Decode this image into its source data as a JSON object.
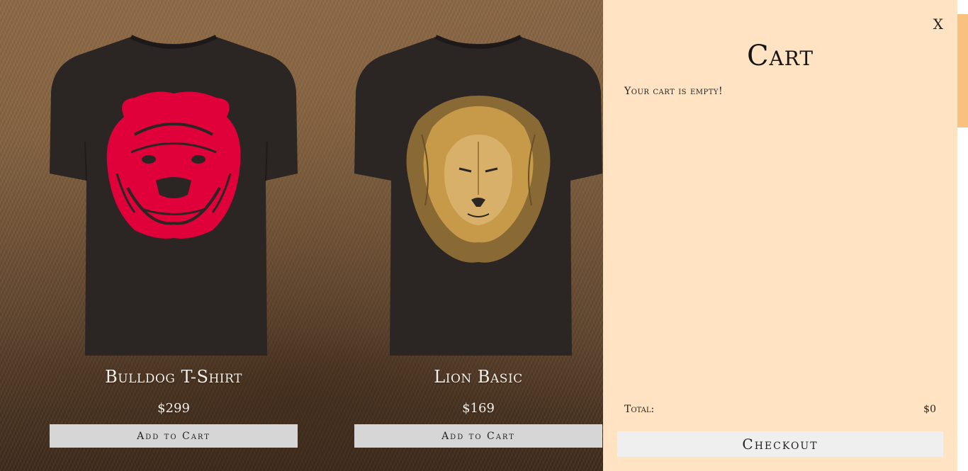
{
  "products": [
    {
      "name": "Bulldog T-Shirt",
      "price": "$299",
      "add_label": "Add to Cart",
      "print_icon": "bulldog-print",
      "print_color": "#e0003a"
    },
    {
      "name": "Lion Basic",
      "price": "$169",
      "add_label": "Add to Cart",
      "print_icon": "lion-print",
      "print_color": "#c79a4a"
    }
  ],
  "cart": {
    "close_label": "X",
    "title": "Cart",
    "empty_message": "Your cart is empty!",
    "total_label": "Total:",
    "total_value": "$0",
    "checkout_label": "Checkout",
    "background": "#ffe3c2",
    "scrollbar_color": "#f8c27e"
  }
}
